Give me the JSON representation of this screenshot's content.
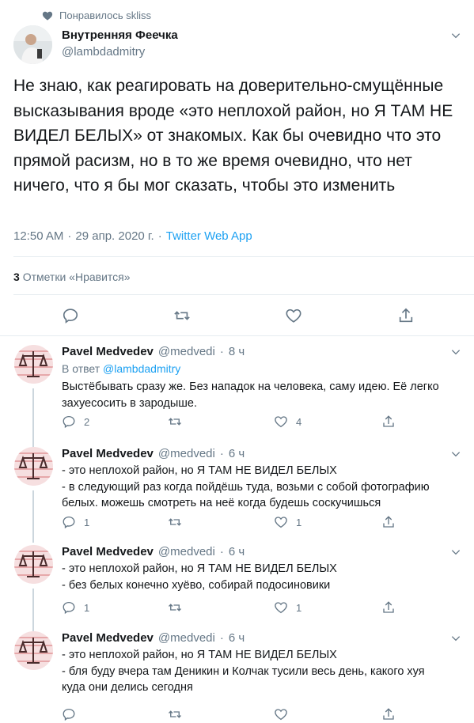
{
  "context": {
    "icon": "heart-icon",
    "text": "Понравилось skliss"
  },
  "main_tweet": {
    "author_name": "Внутренняя Феечка",
    "author_handle": "@lambdadmitry",
    "text": "Не знаю, как реагировать на доверительно-смущённые высказывания вроде «это неплохой район, но Я ТАМ НЕ ВИДЕЛ БЕЛЫХ» от знакомых. Как бы очевидно что это прямой расизм, но в то же время очевидно, что нет ничего, что я бы мог сказать, чтобы это изменить",
    "time": "12:50 AM",
    "separator": "·",
    "date": "29 апр. 2020 г.",
    "source": "Twitter Web App",
    "likes_count": "3",
    "likes_label": "Отметки «Нравится»"
  },
  "replies": [
    {
      "author_name": "Pavel Medvedev",
      "author_handle": "@medvedi",
      "time": "8 ч",
      "reply_to_prefix": "В ответ",
      "reply_to_handle": "@lambdadmitry",
      "lines": [
        "Выстёбывать сразу же. Без нападок на человека, саму идею. Её легко",
        "захуесосить в зародыше."
      ],
      "reply_count": "2",
      "retweet_count": "",
      "like_count": "4"
    },
    {
      "author_name": "Pavel Medvedev",
      "author_handle": "@medvedi",
      "time": "6 ч",
      "lines": [
        "- это неплохой район, но Я ТАМ НЕ ВИДЕЛ БЕЛЫХ",
        "- в следующий раз когда пойдёшь туда, возьми с собой фотографию",
        "белых. можешь смотреть на неё когда будешь соскучишься"
      ],
      "reply_count": "1",
      "retweet_count": "",
      "like_count": "1"
    },
    {
      "author_name": "Pavel Medvedev",
      "author_handle": "@medvedi",
      "time": "6 ч",
      "lines": [
        "- это неплохой район, но Я ТАМ НЕ ВИДЕЛ БЕЛЫХ",
        "- без белых конечно хуёво, собирай подосиновики"
      ],
      "reply_count": "1",
      "retweet_count": "",
      "like_count": "1"
    },
    {
      "author_name": "Pavel Medvedev",
      "author_handle": "@medvedi",
      "time": "6 ч",
      "lines": [
        "- это неплохой район, но Я ТАМ НЕ ВИДЕЛ БЕЛЫХ",
        "- бля буду вчера там Деникин и Колчак тусили весь день, какого хуя",
        "куда они делись сегодня"
      ],
      "reply_count": "",
      "retweet_count": "",
      "like_count": ""
    }
  ],
  "colors": {
    "text": "#14171a",
    "secondary": "#657786",
    "link": "#1da1f2",
    "divider": "#e6ecf0",
    "thread": "#ccd6dd"
  }
}
